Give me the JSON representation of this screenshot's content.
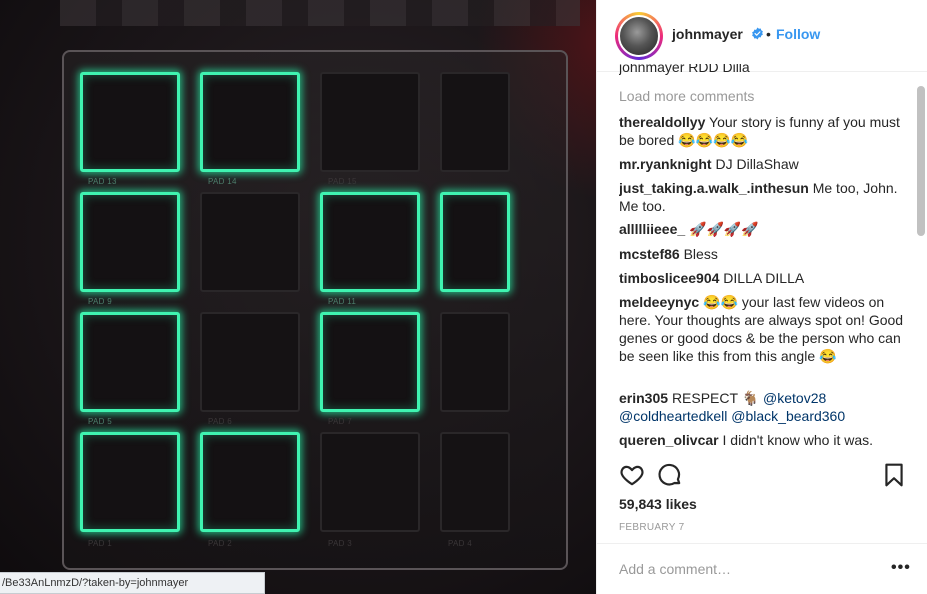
{
  "media": {
    "pad_labels": {
      "pad13": "PAD 13",
      "pad14": "PAD 14",
      "pad15": "PAD 15",
      "pad9": "PAD 9",
      "pad11": "PAD 11",
      "pad5": "PAD 5",
      "pad6": "PAD 6",
      "pad7": "PAD 7",
      "pad1": "PAD 1",
      "pad2": "PAD 2",
      "pad3": "PAD 3",
      "pad4": "PAD 4"
    },
    "glow_color": "#3ff3b0"
  },
  "status_url": "/Be33AnLnmzD/?taken-by=johnmayer",
  "header": {
    "username": "johnmayer",
    "verified_icon": "verified-badge-icon",
    "separator": "•",
    "follow_label": "Follow"
  },
  "comments": {
    "cut_off_text": "johnmayer RDD Dilla",
    "load_more": "Load more comments",
    "items": [
      {
        "user": "therealdollyy",
        "text": "Your story is funny af you must be bored 😂😂😂😂"
      },
      {
        "user": "mr.ryanknight",
        "text": "DJ DillaShaw"
      },
      {
        "user": "just_taking.a.walk_.inthesun",
        "text": "Me too, John. Me too."
      },
      {
        "user": "allllliieee_",
        "text": "🚀🚀🚀🚀"
      },
      {
        "user": "mcstef86",
        "text": "Bless"
      },
      {
        "user": "timboslicee904",
        "text": "DILLA DILLA"
      },
      {
        "user": "meldeeynyc",
        "text": "😂😂 your last few videos on here. Your thoughts are always spot on! Good genes or good docs & be the person who can be seen like this from this angle 😂"
      },
      {
        "user": "erin305",
        "text": "RESPECT 🐐",
        "mentions": [
          "@ketov28",
          "@coldheartedkell",
          "@black_beard360"
        ]
      },
      {
        "user": "queren_olivcar",
        "text": "I didn't know who it was."
      }
    ]
  },
  "actions": {
    "like_icon": "heart-icon",
    "comment_icon": "comment-bubble-icon",
    "save_icon": "bookmark-icon"
  },
  "likes": "59,843 likes",
  "date": "FEBRUARY 7",
  "comment_bar": {
    "placeholder": "Add a comment…",
    "more_label": "•••"
  },
  "colors": {
    "link_blue": "#3897f0",
    "mention_blue": "#003569",
    "muted_grey": "#999999",
    "text_dark": "#262626"
  }
}
